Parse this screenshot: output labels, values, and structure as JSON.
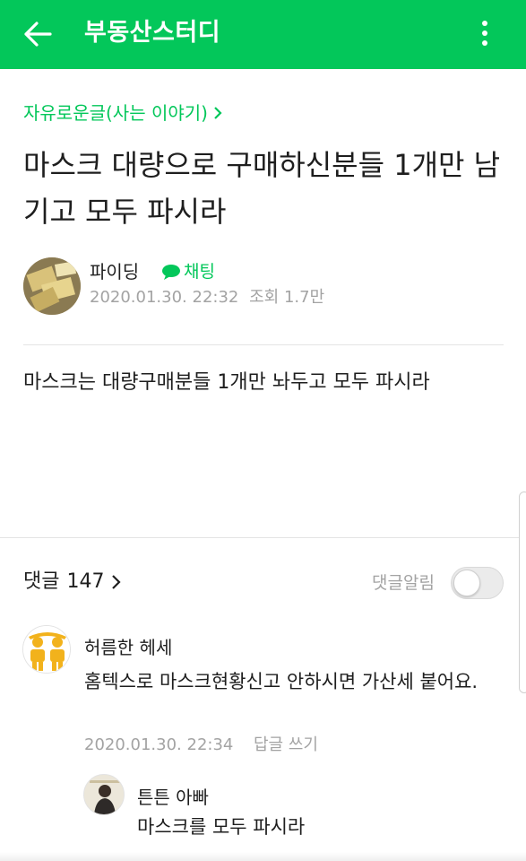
{
  "header": {
    "title": "부동산스터디",
    "back_icon": "arrow-left-icon",
    "more_icon": "kebab-menu-icon",
    "bg_color": "#03c75a"
  },
  "post": {
    "board": "자유로운글(사는 이야기)",
    "title": "마스크 대량으로 구매하신분들 1개만 남기고 모두 파시라",
    "author": "파이딩",
    "chat_label": "채팅",
    "date": "2020.01.30. 22:32",
    "views": "조회 1.7만",
    "body": "마스크는 대량구매분들 1개만 놔두고 모두 파시라"
  },
  "comments": {
    "label": "댓글",
    "count": "147",
    "alert_label": "댓글알림",
    "alert_on": false,
    "items": [
      {
        "author": "허름한 헤세",
        "text": "홈텍스로 마스크현황신고 안하시면 가산세 붙어요.",
        "date": "2020.01.30. 22:34",
        "reply_label": "답글 쓰기"
      },
      {
        "author": "튼튼 아빠",
        "text": "마스크를 모두 파시라"
      }
    ]
  }
}
